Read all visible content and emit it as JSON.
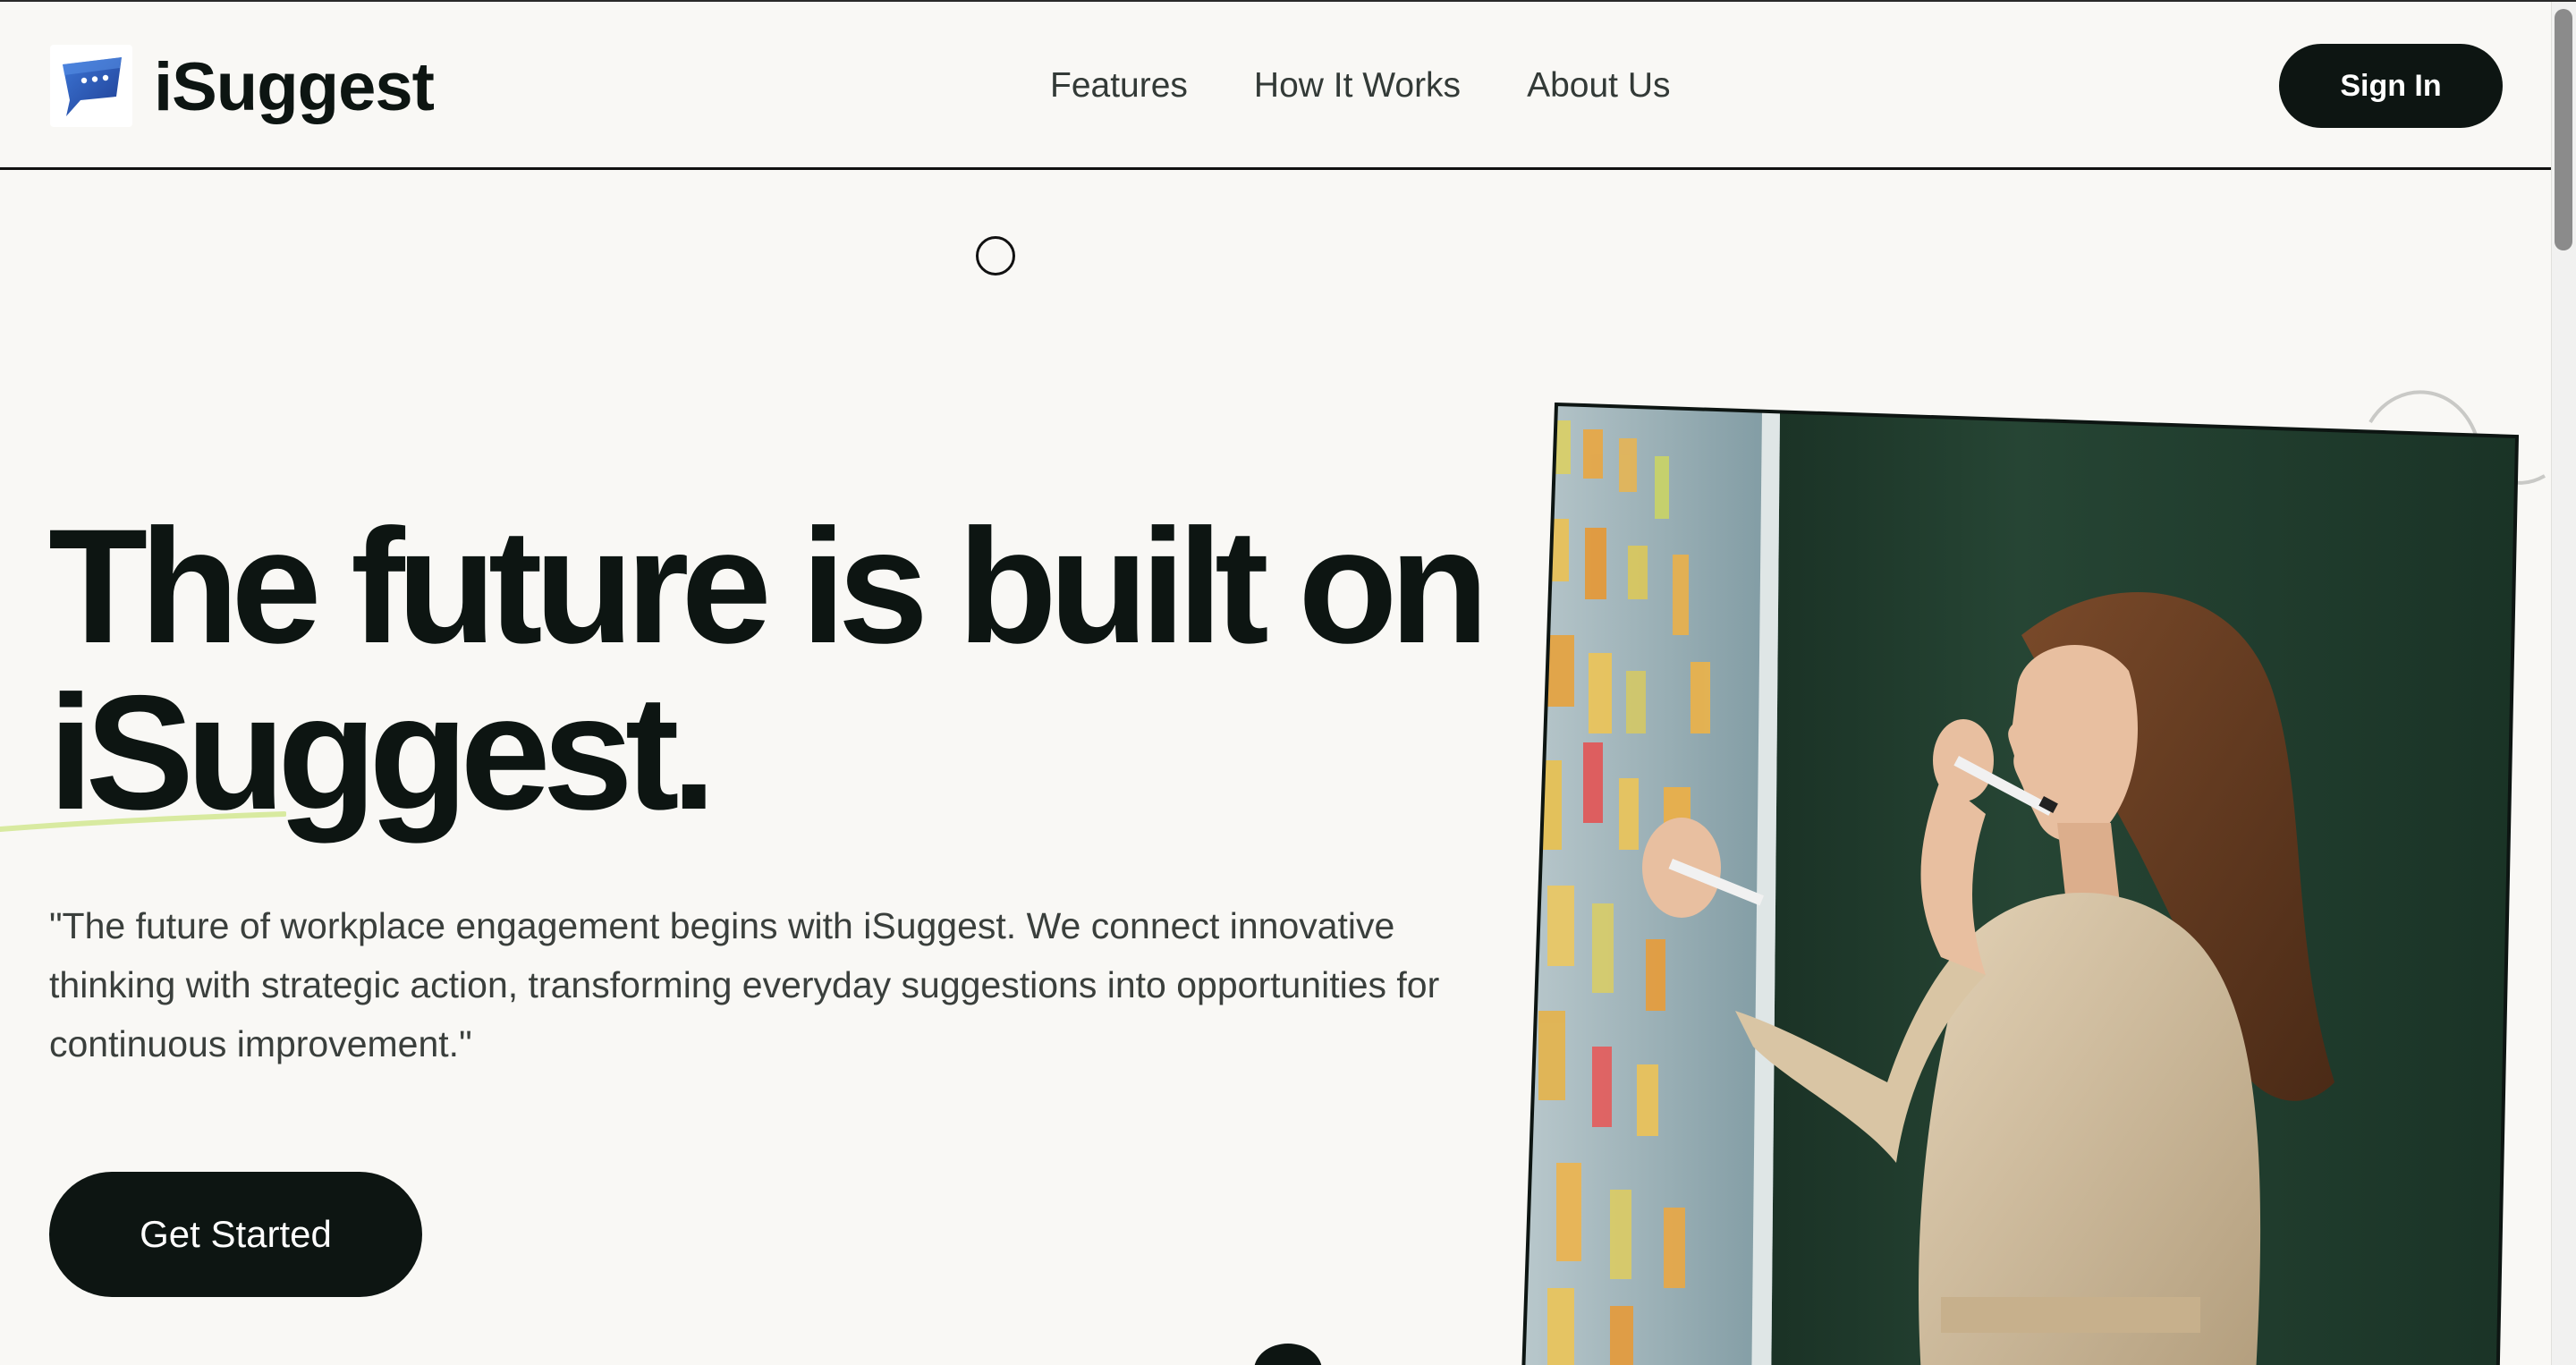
{
  "app": {
    "brand_name": "iSuggest",
    "logo_icon": "speech-bubble-flag-icon",
    "accent_color": "#0d1512",
    "logo_colors": [
      "#2a4fa8",
      "#3d76d6"
    ]
  },
  "nav": {
    "items": [
      {
        "label": "Features"
      },
      {
        "label": "How It Works"
      },
      {
        "label": "About Us"
      }
    ],
    "signin_label": "Sign In"
  },
  "hero": {
    "headline_line1": "The future is built on",
    "headline_line2": "iSuggest.",
    "quote": "\"The future of workplace engagement begins with iSuggest. We connect innovative thinking with strategic action, transforming everyday suggestions into opportunities for continuous improvement.\"",
    "cta_label": "Get Started",
    "image_icon": "woman-writing-sticky-notes-photo"
  }
}
